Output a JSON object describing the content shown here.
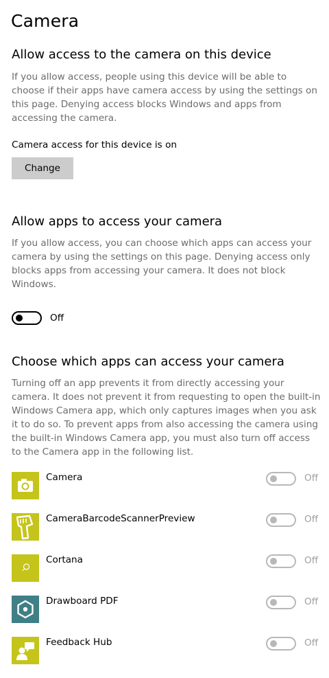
{
  "page_title": "Camera",
  "device_section": {
    "heading": "Allow access to the camera on this device",
    "description": "If you allow access, people using this device will be able to choose if their apps have camera access by using the settings on this page. Denying access blocks Windows and apps from accessing the camera.",
    "status": "Camera access for this device is on",
    "change_button": "Change"
  },
  "apps_section": {
    "heading": "Allow apps to access your camera",
    "description": "If you allow access, you can choose which apps can access your camera by using the settings on this page. Denying access only blocks apps from accessing your camera. It does not block Windows.",
    "toggle_state": "Off"
  },
  "choose_section": {
    "heading": "Choose which apps can access your camera",
    "description": "Turning off an app prevents it from directly accessing your camera. It does not prevent it from requesting to open the built-in Windows Camera app, which only captures images when you ask it to do so. To prevent apps from also accessing the camera using the built-in Windows Camera app, you must also turn off access to the Camera app in the following list."
  },
  "apps": [
    {
      "name": "Camera",
      "state": "Off",
      "icon": "camera-icon",
      "icon_color": "#c5c41b"
    },
    {
      "name": "CameraBarcodeScannerPreview",
      "state": "Off",
      "icon": "barcode-scanner-icon",
      "icon_color": "#c5c41b"
    },
    {
      "name": "Cortana",
      "state": "Off",
      "icon": "search-icon",
      "icon_color": "#c5c41b"
    },
    {
      "name": "Drawboard PDF",
      "state": "Off",
      "icon": "hexagon-icon",
      "icon_color": "#3f7f86"
    },
    {
      "name": "Feedback Hub",
      "state": "Off",
      "icon": "feedback-icon",
      "icon_color": "#c5c41b"
    }
  ]
}
